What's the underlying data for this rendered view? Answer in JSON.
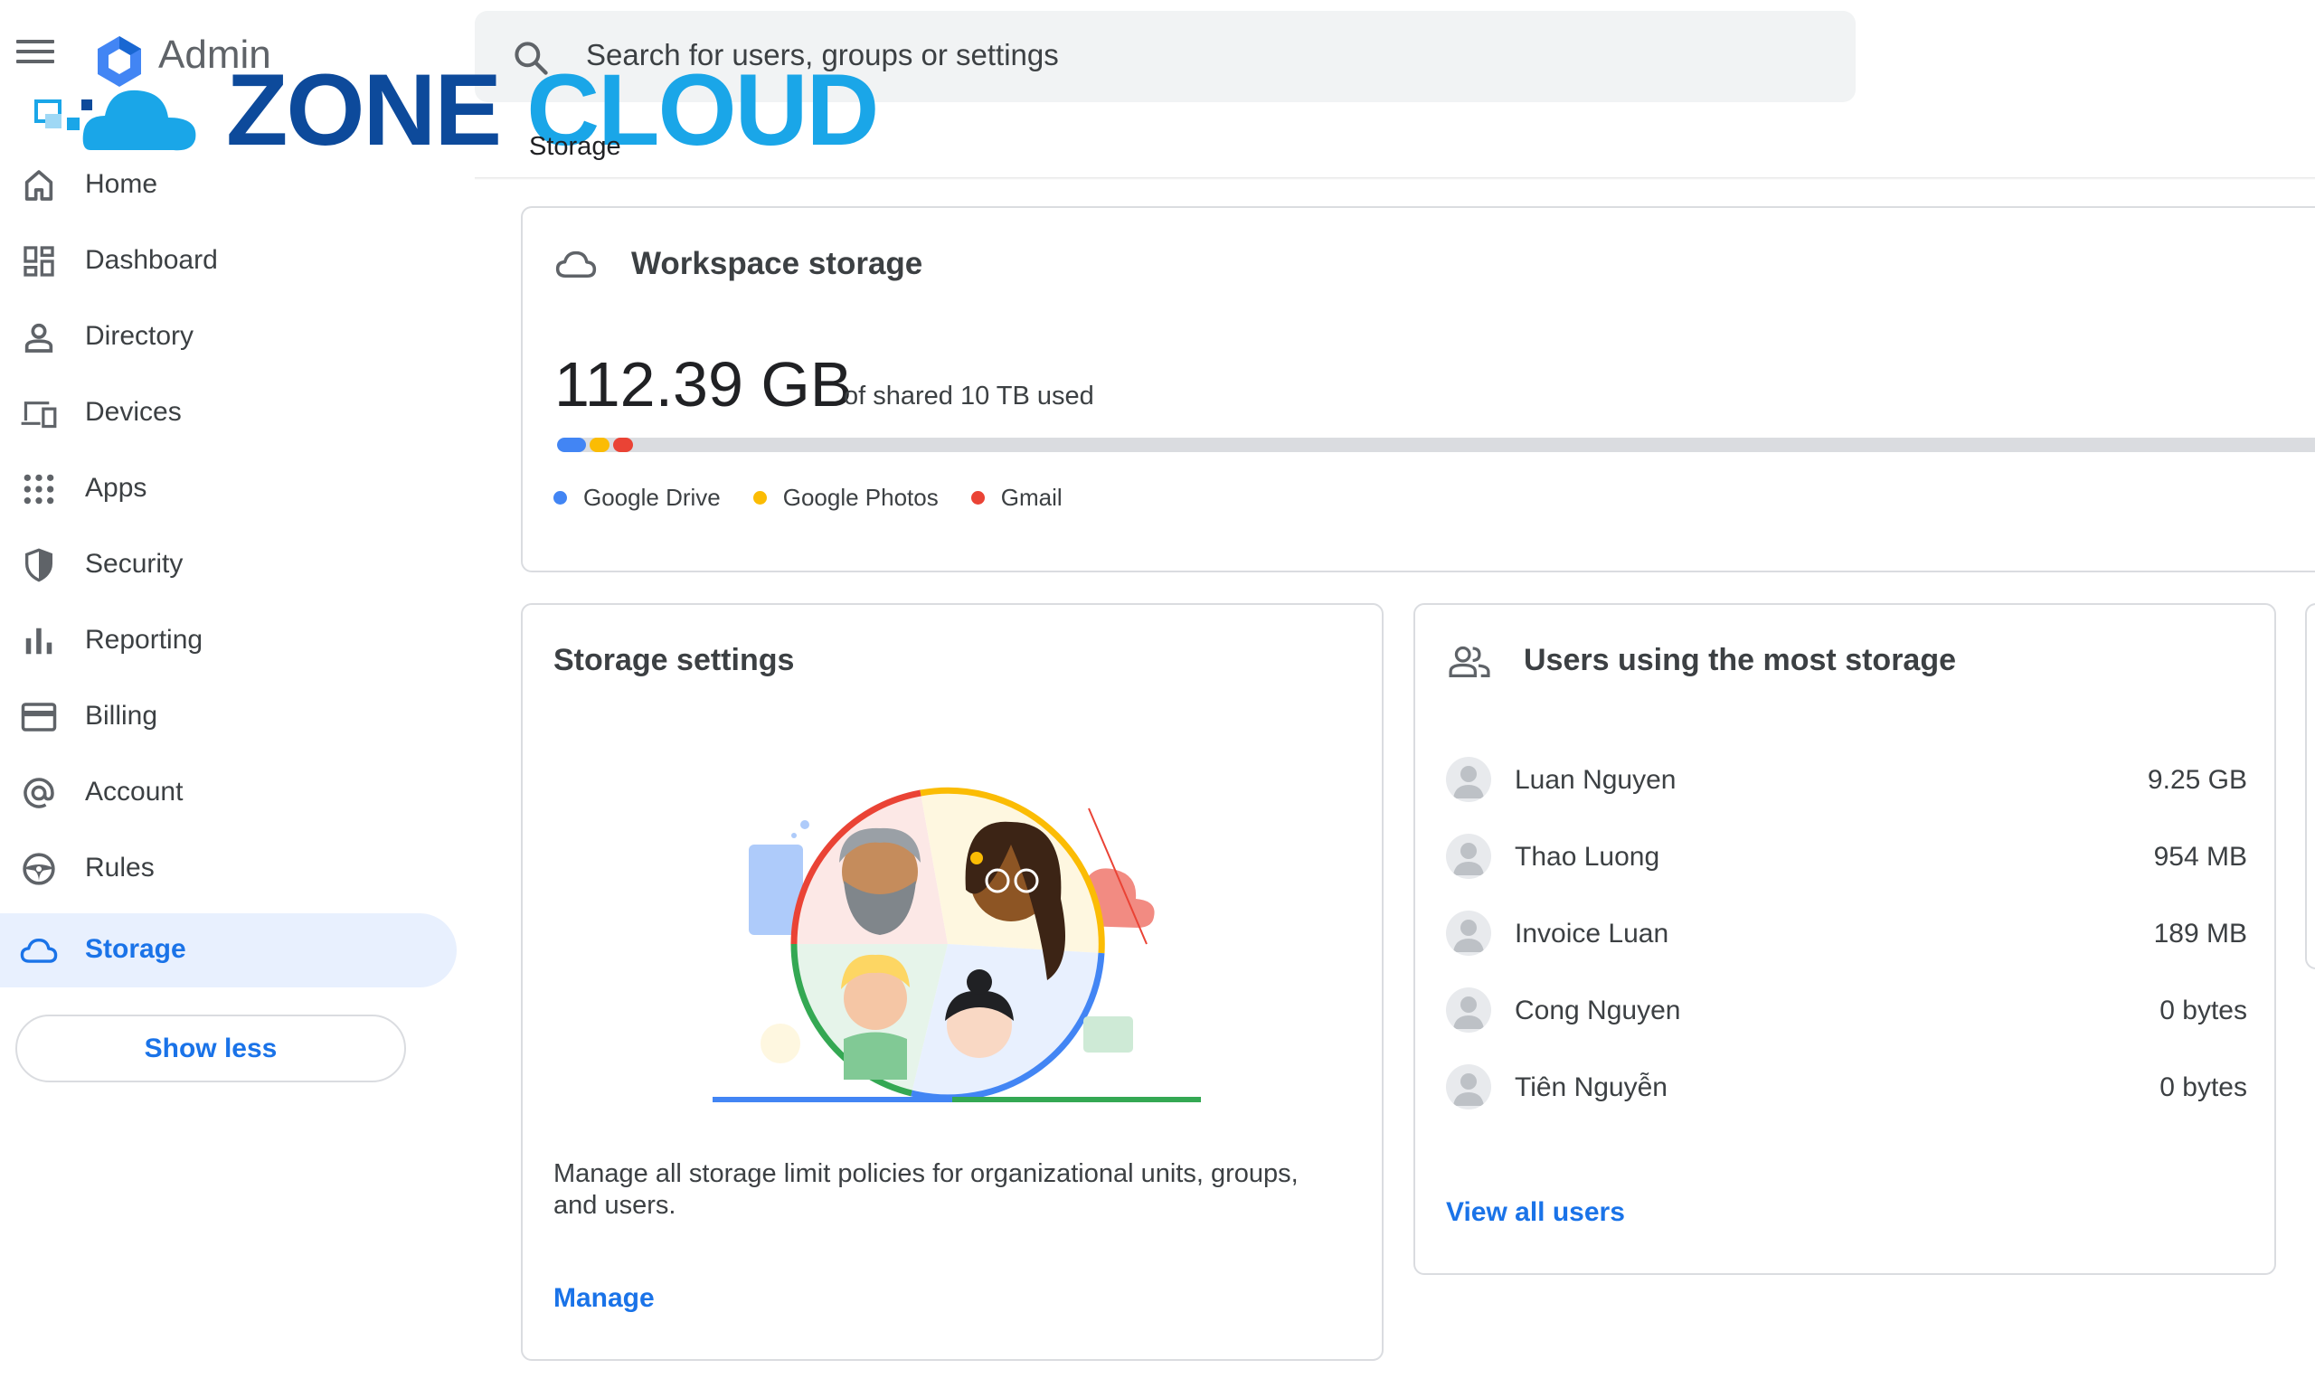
{
  "header": {
    "app_name": "Admin",
    "menu_icon": "hamburger-menu-icon",
    "logo_icon": "google-admin-hexagon-icon",
    "search_placeholder": "Search for users, groups or settings",
    "search_icon": "search-icon"
  },
  "watermark": {
    "text_1": "ZONE",
    "text_2": "CLOUD"
  },
  "breadcrumb": "Storage",
  "sidebar": {
    "items": [
      {
        "label": "Home",
        "icon": "home-icon"
      },
      {
        "label": "Dashboard",
        "icon": "dashboard-icon"
      },
      {
        "label": "Directory",
        "icon": "person-icon"
      },
      {
        "label": "Devices",
        "icon": "devices-icon"
      },
      {
        "label": "Apps",
        "icon": "apps-grid-icon"
      },
      {
        "label": "Security",
        "icon": "shield-icon"
      },
      {
        "label": "Reporting",
        "icon": "bar-chart-icon"
      },
      {
        "label": "Billing",
        "icon": "credit-card-icon"
      },
      {
        "label": "Account",
        "icon": "at-sign-icon"
      },
      {
        "label": "Rules",
        "icon": "steering-wheel-icon"
      },
      {
        "label": "Storage",
        "icon": "cloud-icon",
        "active": true
      }
    ],
    "show_less": "Show less"
  },
  "workspace_storage": {
    "title": "Workspace storage",
    "used": "112.39 GB",
    "of_total": "of shared 10 TB used",
    "legend": [
      {
        "label": "Google Drive",
        "color": "#4285f4"
      },
      {
        "label": "Google Photos",
        "color": "#fbbc04"
      },
      {
        "label": "Gmail",
        "color": "#ea4335"
      }
    ]
  },
  "storage_settings": {
    "title": "Storage settings",
    "description": "Manage all storage limit policies for organizational units, groups, and users.",
    "link": "Manage"
  },
  "top_users": {
    "title": "Users using the most storage",
    "users": [
      {
        "name": "Luan Nguyen",
        "size": "9.25 GB"
      },
      {
        "name": "Thao Luong",
        "size": "954 MB"
      },
      {
        "name": "Invoice Luan",
        "size": "189 MB"
      },
      {
        "name": "Cong Nguyen",
        "size": "0 bytes"
      },
      {
        "name": "Tiên Nguyễn",
        "size": "0 bytes"
      }
    ],
    "link": "View all users"
  },
  "colors": {
    "accent": "#1a73e8",
    "active_bg": "#e8f0fe"
  }
}
